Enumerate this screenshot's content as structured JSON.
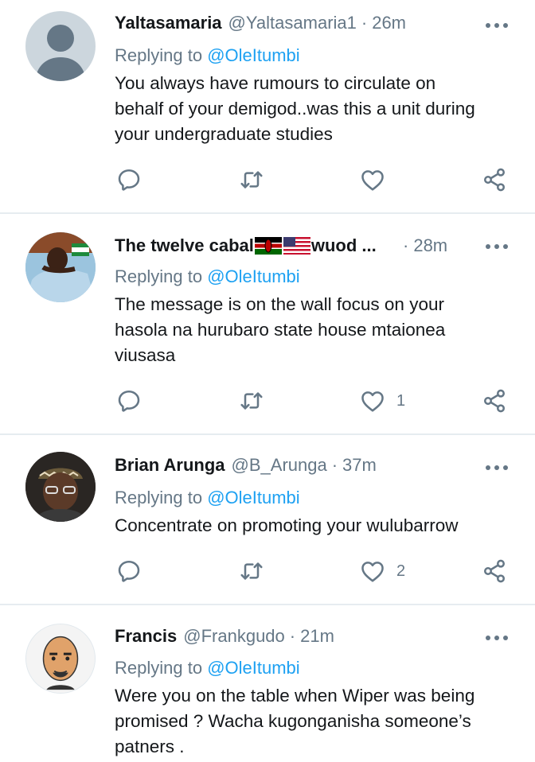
{
  "tweets": [
    {
      "name": "Yaltasamaria",
      "handle": "@Yaltasamaria1",
      "time": "26m",
      "replying_prefix": "Replying to",
      "replying_to": "@OleItumbi",
      "lines": [
        "You always have rumours to circulate on",
        "behalf of your demigod..was this a unit during",
        "your undergraduate studies"
      ],
      "likes": ""
    },
    {
      "name_prefix": "The twelve cabal",
      "name_suffix": "wuod ...",
      "flags": [
        "kenya-flag",
        "us-flag"
      ],
      "time": "28m",
      "replying_prefix": "Replying to",
      "replying_to": "@OleItumbi",
      "lines": [
        "The message is on the wall focus on your",
        "hasola na hurubaro state house mtaionea",
        "viusasa"
      ],
      "likes": "1"
    },
    {
      "name": "Brian Arunga",
      "handle": "@B_Arunga",
      "time": "37m",
      "replying_prefix": "Replying to",
      "replying_to": "@OleItumbi",
      "lines": [
        "Concentrate on promoting your wulubarrow"
      ],
      "likes": "2"
    },
    {
      "name": "Francis",
      "handle": "@Frankgudo",
      "time": "21m",
      "replying_prefix": "Replying to",
      "replying_to": "@OleItumbi",
      "lines": [
        "Were you on the table when Wiper was being",
        "promised ? Wacha kugonganisha someone’s",
        "patners ."
      ]
    }
  ],
  "separator": "·",
  "colors": {
    "accent": "#1da1f2",
    "secondary_text": "#657786",
    "primary_text": "#14171a",
    "divider": "#e6ecf0"
  },
  "icons": [
    "reply-icon",
    "retweet-icon",
    "like-icon",
    "share-icon",
    "more-icon"
  ]
}
